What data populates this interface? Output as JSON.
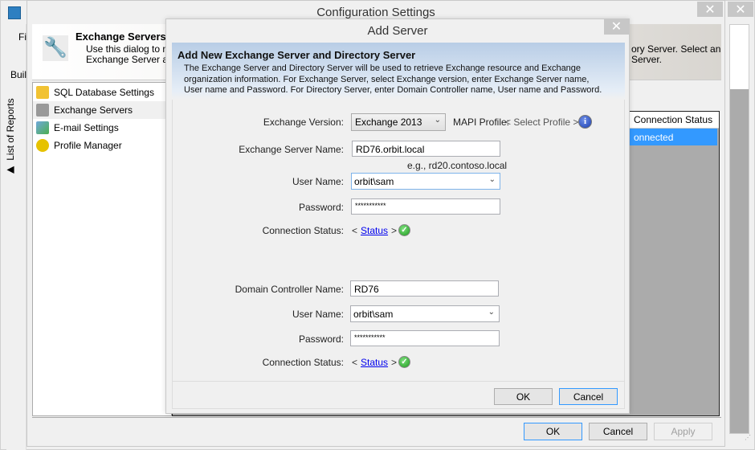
{
  "app": {
    "menu_fragment": "Fi",
    "tab_fragment": "Buil",
    "side_tab": "List of Reports"
  },
  "config": {
    "title": "Configuration Settings",
    "header_title": "Exchange Servers",
    "header_desc_left_1": "Use this dialog to ma",
    "header_desc_left_2": "Exchange Server and",
    "header_desc_right_1": "ory Server. Select an",
    "header_desc_right_2": "Server.",
    "nav": [
      {
        "label": "SQL Database Settings",
        "icon": "database-icon"
      },
      {
        "label": "Exchange Servers",
        "icon": "servers-icon",
        "selected": true
      },
      {
        "label": "E-mail Settings",
        "icon": "email-icon"
      },
      {
        "label": "Profile Manager",
        "icon": "key-icon"
      }
    ],
    "grid": {
      "column": "Connection Status",
      "rows": [
        "onnected"
      ]
    },
    "buttons": {
      "ok": "OK",
      "cancel": "Cancel",
      "apply": "Apply"
    }
  },
  "dialog": {
    "title": "Add Server",
    "heading": "Add New Exchange Server and Directory Server",
    "description": "The Exchange Server and Directory Server will be used to retrieve Exchange resource and Exchange organization information. For Exchange Server, select Exchange version, enter Exchange Server name, User name and Password. For Directory Server, enter Domain Controller name, User name and Password.",
    "exchange": {
      "version_label": "Exchange Version:",
      "version_value": "Exchange 2013",
      "mapi_label": "MAPI Profile:",
      "mapi_value": "< Select Profile >",
      "server_label": "Exchange Server Name:",
      "server_value": "RD76.orbit.local",
      "server_hint": "e.g., rd20.contoso.local",
      "user_label": "User Name:",
      "user_value": "orbit\\sam",
      "password_label": "Password:",
      "password_value": "***********",
      "status_label": "Connection Status:",
      "status_pre": "<",
      "status_link": "Status",
      "status_post": ">"
    },
    "directory": {
      "dc_label": "Domain Controller Name:",
      "dc_value": "RD76",
      "user_label": "User Name:",
      "user_value": "orbit\\sam",
      "password_label": "Password:",
      "password_value": "***********",
      "status_label": "Connection Status:",
      "status_pre": "<",
      "status_link": "Status",
      "status_post": ">"
    },
    "buttons": {
      "ok": "OK",
      "cancel": "Cancel"
    }
  },
  "colors": {
    "selection": "#3399ff",
    "accent_border": "#3399ff",
    "status_ok": "#1e9a1e"
  }
}
